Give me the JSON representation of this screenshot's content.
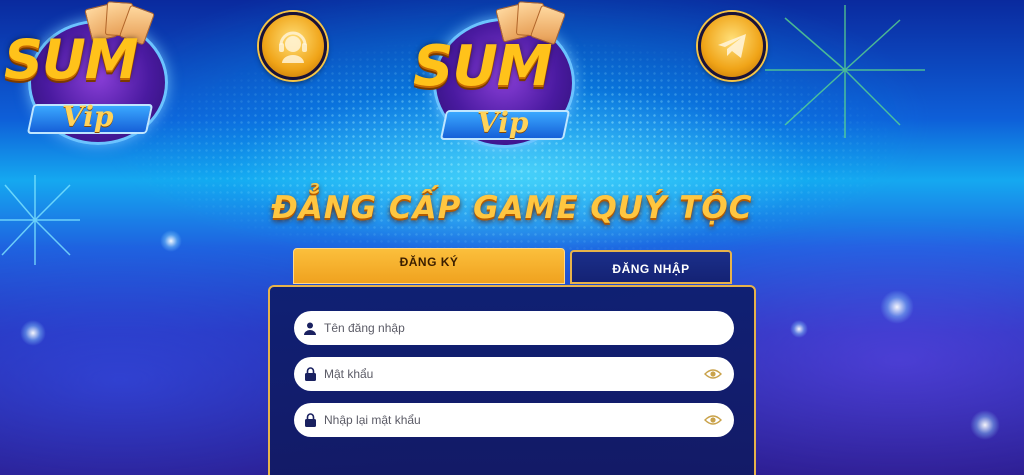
{
  "logo": {
    "word": "SUM",
    "sub": "Vip"
  },
  "icons": {
    "support": "headset-icon",
    "telegram": "telegram-icon"
  },
  "slogan": "ĐẲNG CẤP GAME QUÝ TỘC",
  "tabs": {
    "register": "ĐĂNG KÝ",
    "login": "ĐĂNG NHẬP"
  },
  "form": {
    "username_placeholder": "Tên đăng nhập",
    "password_placeholder": "Mật khẩu",
    "confirm_password_placeholder": "Nhập lại mật khẩu"
  },
  "colors": {
    "accent": "#f0a21f",
    "border_gold": "#e7b34a",
    "panel": "#142274"
  }
}
